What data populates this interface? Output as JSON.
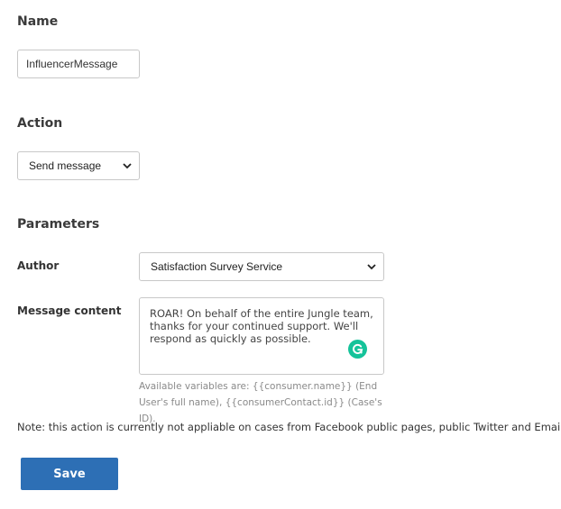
{
  "name_section": {
    "heading": "Name",
    "input_value": "InfluencerMessage"
  },
  "action_section": {
    "heading": "Action",
    "selected": "Send message"
  },
  "parameters_section": {
    "heading": "Parameters",
    "author_label": "Author",
    "author_selected": "Satisfaction Survey Service",
    "message_label": "Message content",
    "message_text": "ROAR! On behalf of the entire Jungle team, thanks for your continued support. We'll respond as quickly as possible.",
    "help_text": "Available variables are: {{consumer.name}} (End User's full name), {{consumerContact.id}} (Case's ID)."
  },
  "note": "Note: this action is currently not appliable on cases from Facebook public pages, public Twitter and Email.",
  "save_label": "Save",
  "colors": {
    "primary_button": "#2d6fb5",
    "grammarly": "#15c39a"
  },
  "icons": {
    "select_chevron": "chevron-down-icon",
    "grammarly": "grammarly-icon"
  }
}
